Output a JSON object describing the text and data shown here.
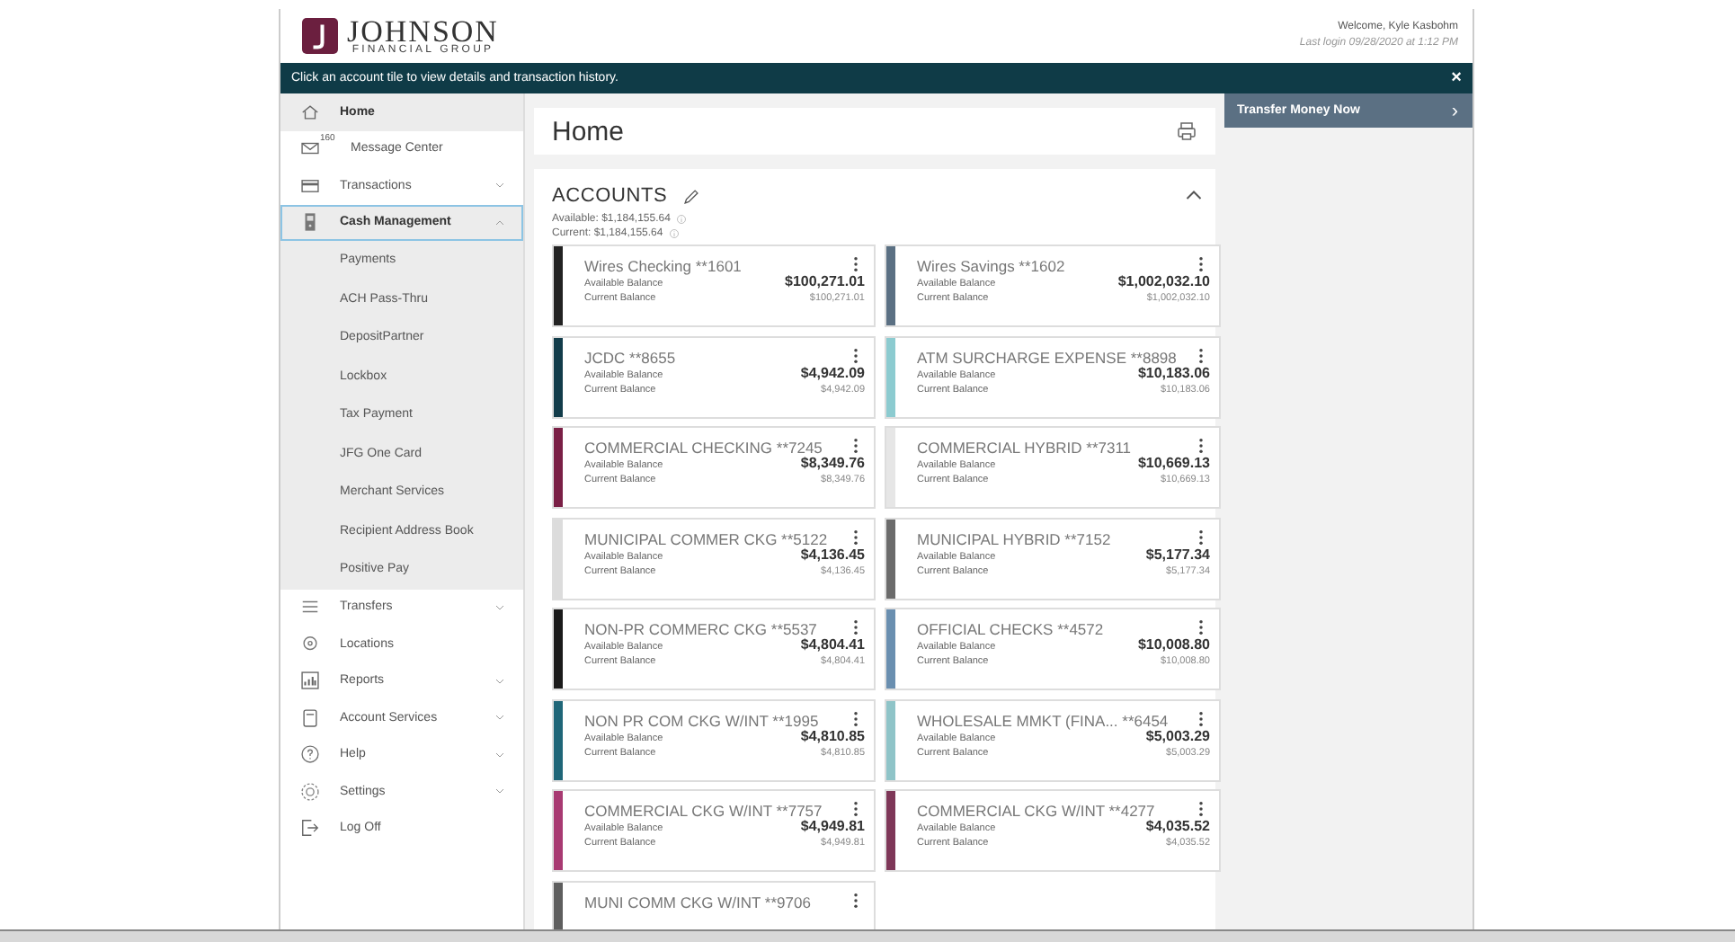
{
  "header": {
    "logo_title": "JOHNSON",
    "logo_subtitle": "FINANCIAL GROUP",
    "welcome": "Welcome, Kyle Kasbohm",
    "last_login": "Last login 09/28/2020 at 1:12 PM"
  },
  "banner": {
    "message": "Click an account tile to view details and transaction history.",
    "close": "×"
  },
  "sidebar": {
    "items": [
      {
        "label": "Home",
        "selected": true
      },
      {
        "label": "Message Center",
        "selected": false,
        "badge": "160"
      },
      {
        "label": "Transactions",
        "selected": false,
        "expanded": false
      },
      {
        "label": "Cash Management",
        "selected": true,
        "expanded": true,
        "children": [
          {
            "label": "Payments"
          },
          {
            "label": "ACH Pass-Thru"
          },
          {
            "label": "DepositPartner"
          },
          {
            "label": "Lockbox"
          },
          {
            "label": "Tax Payment"
          },
          {
            "label": "JFG One Card"
          },
          {
            "label": "Merchant Services"
          },
          {
            "label": "Recipient Address Book"
          },
          {
            "label": "Positive Pay"
          }
        ]
      },
      {
        "label": "Transfers",
        "selected": false,
        "expanded": false
      },
      {
        "label": "Locations",
        "selected": false
      },
      {
        "label": "Reports",
        "selected": false,
        "expanded": false
      },
      {
        "label": "Account Services",
        "selected": false,
        "expanded": false
      },
      {
        "label": "Help",
        "selected": false,
        "expanded": false
      },
      {
        "label": "Settings",
        "selected": false,
        "expanded": false
      },
      {
        "label": "Log Off",
        "selected": false
      }
    ]
  },
  "page_title": "Home",
  "accounts": {
    "title": "ACCOUNTS",
    "expanded": true,
    "available_total": "Available: $1,184,155.64",
    "current_total": "Current: $1,184,155.64",
    "tiles": [
      {
        "name": "Wires Checking **1601",
        "color": "#222222",
        "available_label": "Available Balance",
        "available": "$100,271.01",
        "current_label": "Current Balance",
        "current": "$100,271.01"
      },
      {
        "name": "Wires Savings **1602",
        "color": "#5b7083",
        "available_label": "Available Balance",
        "available": "$1,002,032.10",
        "current_label": "Current Balance",
        "current": "$1,002,032.10"
      },
      {
        "name": "JCDC **8655",
        "color": "#123c4a",
        "available_label": "Available Balance",
        "available": "$4,942.09",
        "current_label": "Current Balance",
        "current": "$4,942.09"
      },
      {
        "name": "ATM SURCHARGE EXPENSE **8898",
        "color": "#8ccbd0",
        "available_label": "Available Balance",
        "available": "$10,183.06",
        "current_label": "Current Balance",
        "current": "$10,183.06"
      },
      {
        "name": "COMMERCIAL CHECKING **7245",
        "color": "#7a1f45",
        "available_label": "Available Balance",
        "available": "$8,349.76",
        "current_label": "Current Balance",
        "current": "$8,349.76"
      },
      {
        "name": "COMMERCIAL HYBRID **7311",
        "color": "#e6e6e6",
        "available_label": "Available Balance",
        "available": "$10,669.13",
        "current_label": "Current Balance",
        "current": "$10,669.13"
      },
      {
        "name": "MUNICIPAL COMMER CKG **5122",
        "color": "#dcdcdc",
        "available_label": "Available Balance",
        "available": "$4,136.45",
        "current_label": "Current Balance",
        "current": "$4,136.45"
      },
      {
        "name": "MUNICIPAL HYBRID **7152",
        "color": "#6b6b6b",
        "available_label": "Available Balance",
        "available": "$5,177.34",
        "current_label": "Current Balance",
        "current": "$5,177.34"
      },
      {
        "name": "NON-PR COMMERC CKG **5537",
        "color": "#1a1a1a",
        "available_label": "Available Balance",
        "available": "$4,804.41",
        "current_label": "Current Balance",
        "current": "$4,804.41"
      },
      {
        "name": "OFFICIAL CHECKS **4572",
        "color": "#6a8fb0",
        "available_label": "Available Balance",
        "available": "$10,008.80",
        "current_label": "Current Balance",
        "current": "$10,008.80"
      },
      {
        "name": "NON PR COM CKG W/INT **1995",
        "color": "#1f6678",
        "available_label": "Available Balance",
        "available": "$4,810.85",
        "current_label": "Current Balance",
        "current": "$4,810.85"
      },
      {
        "name": "WHOLESALE MMKT (FINA... **6454",
        "color": "#8fc4c8",
        "available_label": "Available Balance",
        "available": "$5,003.29",
        "current_label": "Current Balance",
        "current": "$5,003.29"
      },
      {
        "name": "COMMERCIAL CKG W/INT **7757",
        "color": "#a83a72",
        "available_label": "Available Balance",
        "available": "$4,949.81",
        "current_label": "Current Balance",
        "current": "$4,949.81"
      },
      {
        "name": "COMMERCIAL CKG W/INT **4277",
        "color": "#7e3758",
        "available_label": "Available Balance",
        "available": "$4,035.52",
        "current_label": "Current Balance",
        "current": "$4,035.52"
      },
      {
        "name": "MUNI COMM CKG W/INT **9706",
        "color": "#5e5e5e"
      }
    ]
  },
  "quick_action": {
    "label": "Transfer Money Now",
    "arrow": "›"
  }
}
